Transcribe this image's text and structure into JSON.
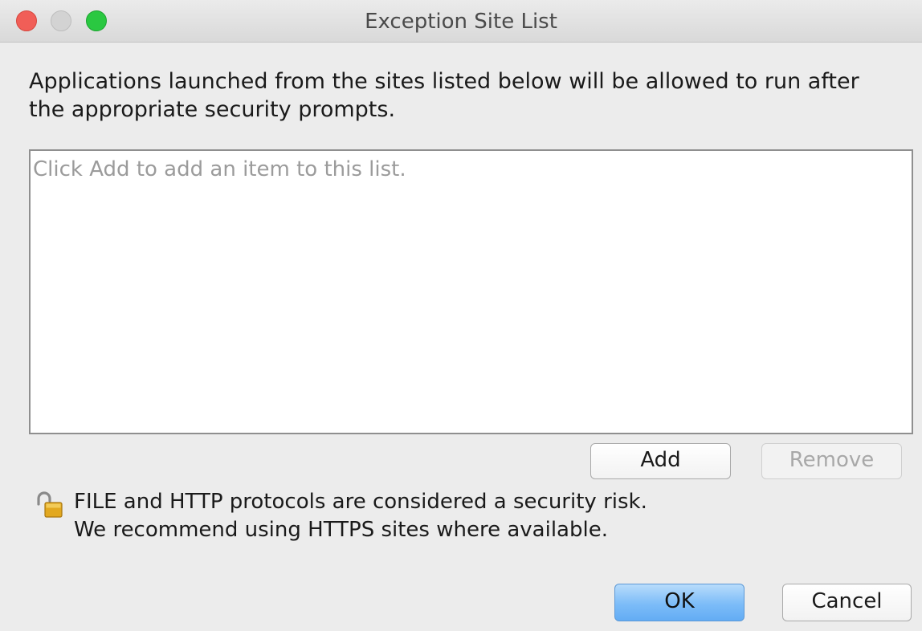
{
  "window": {
    "title": "Exception Site List"
  },
  "description": {
    "line1": "Applications launched from the sites listed below will be allowed to run after",
    "line2": "the appropriate security prompts."
  },
  "site_list": {
    "placeholder": "Click Add to add an item to this list.",
    "items": []
  },
  "list_buttons": {
    "add_label": "Add",
    "remove_label": "Remove"
  },
  "warning": {
    "icon": "unlocked-padlock-icon",
    "line1": "FILE and HTTP protocols are considered a security risk.",
    "line2": "We recommend using HTTPS sites where available."
  },
  "dialog_buttons": {
    "ok_label": "OK",
    "cancel_label": "Cancel"
  },
  "colors": {
    "traffic_close": "#f15e57",
    "traffic_minimize": "#d3d3d3",
    "traffic_zoom": "#2ac841",
    "default_button": "#7cbcf8"
  }
}
